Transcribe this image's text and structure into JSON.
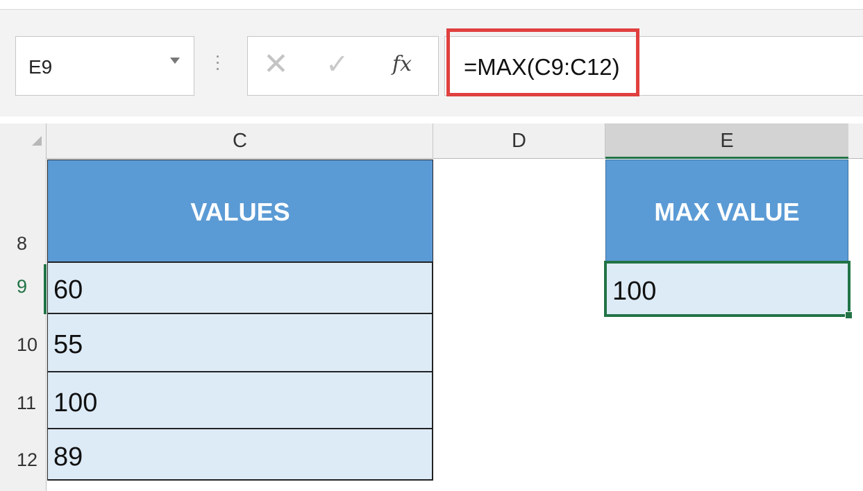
{
  "name_box": {
    "value": "E9"
  },
  "formula_bar": {
    "cancel_icon": "✕",
    "enter_icon": "✓",
    "fx_label": "fx",
    "formula": "=MAX(C9:C12)",
    "highlight_color": "#e0403f"
  },
  "columns": [
    "C",
    "D",
    "E"
  ],
  "rows": [
    "8",
    "9",
    "10",
    "11",
    "12"
  ],
  "table": {
    "header": "VALUES",
    "values": [
      "60",
      "55",
      "100",
      "89"
    ],
    "header_color": "#5b9bd5",
    "cell_color": "#ddebf7"
  },
  "result": {
    "header": "MAX VALUE",
    "value": "100",
    "selection_color": "#217346"
  }
}
